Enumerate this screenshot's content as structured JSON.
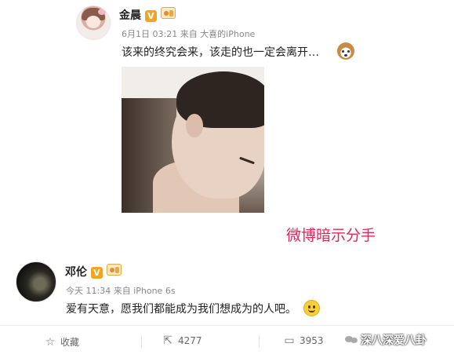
{
  "post1": {
    "author": "金晨",
    "verified_badge": "V",
    "meta": "6月1日 03:21 来自 大喜的iPhone",
    "text": "该来的终究会来，该走的也一定会离开…",
    "emoji": "dog-emoji"
  },
  "caption": "微博暗示分手",
  "post2": {
    "author": "邓伦",
    "verified_badge": "V",
    "meta": "今天 11:34 来自 iPhone 6s",
    "text": "爱有天意，愿我们都能成为我们想成为的人吧。",
    "emoji": "smile-emoji"
  },
  "actions": {
    "favorite_label": "收藏",
    "repost_count": "4277",
    "comment_count": "3953"
  },
  "watermark": "深八深爱八卦"
}
